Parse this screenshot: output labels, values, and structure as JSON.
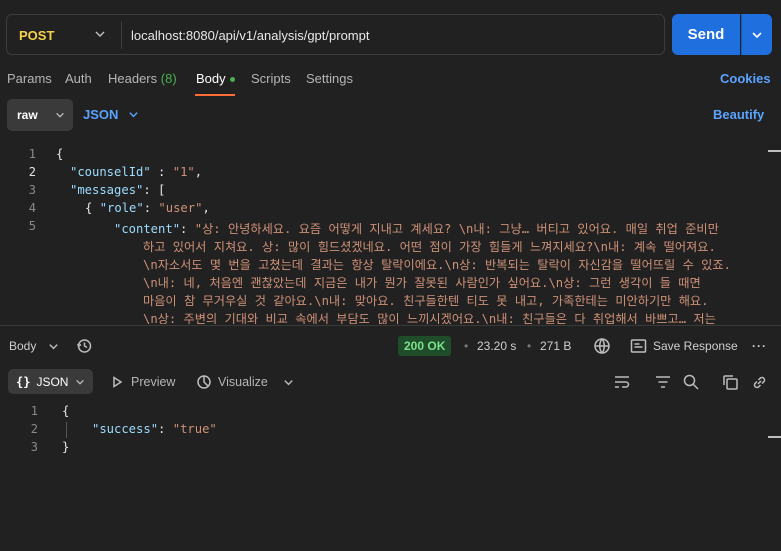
{
  "request": {
    "method": "POST",
    "url": "localhost:8080/api/v1/analysis/gpt/prompt",
    "send_label": "Send"
  },
  "request_tabs": {
    "params": "Params",
    "auth": "Auth",
    "headers": "Headers",
    "headers_count": "(8)",
    "body": "Body",
    "scripts": "Scripts",
    "settings": "Settings",
    "cookies": "Cookies"
  },
  "body_options": {
    "mode": "raw",
    "format": "JSON",
    "beautify": "Beautify"
  },
  "request_body": {
    "line_numbers": [
      "1",
      "2",
      "3",
      "4",
      "5"
    ],
    "line1": "{",
    "counsel_key": "\"counselId\"",
    "counsel_sep": " : ",
    "counsel_val": "\"1\"",
    "messages_key": "\"messages\"",
    "messages_tail": ": [",
    "role_open": "{ ",
    "role_key": "\"role\"",
    "role_sep": ": ",
    "role_val": "\"user\"",
    "content_key": "\"content\"",
    "content_sep": ": ",
    "content_lines": [
      "\"상: 안녕하세요. 요즘 어떻게 지내고 계세요? \\n내: 그냥… 버티고 있어요. 매일 취업 준비만",
      "하고 있어서 지쳐요. 상: 많이 힘드셨겠네요. 어떤 점이 가장 힘들게 느껴지세요?\\n내: 계속 떨어져요.",
      "\\n자소서도 몇 번을 고쳤는데 결과는 항상 탈락이에요.\\n상: 반복되는 탈락이 자신감을 떨어뜨릴 수 있죠.",
      "\\n내: 네, 처음엔 괜찮았는데 지금은 내가 뭔가 잘못된 사람인가 싶어요.\\n상: 그런 생각이 들 때면",
      "마음이 참 무거우실 것 같아요.\\n내: 맞아요. 친구들한텐 티도 못 내고, 가족한테는 미안하기만 해요.",
      "\\n상: 주변의 기대와 비교 속에서 부담도 많이 느끼시겠어요.\\n내: 친구들은 다 취업해서 바쁘고… 저는"
    ]
  },
  "response": {
    "label": "Body",
    "status": "200 OK",
    "time": "23.20 s",
    "size": "271 B",
    "save_label": "Save Response",
    "format": "JSON",
    "preview": "Preview",
    "visualize": "Visualize",
    "line_numbers": [
      "1",
      "2",
      "3"
    ],
    "line1": "{",
    "success_key": "\"success\"",
    "success_sep": ": ",
    "success_val": "\"true\"",
    "line3": "}"
  },
  "colors": {
    "accent_blue": "#1f6fde",
    "method_yellow": "#f5d14a",
    "status_green": "#7be08b",
    "tab_orange": "#ff6c37"
  }
}
